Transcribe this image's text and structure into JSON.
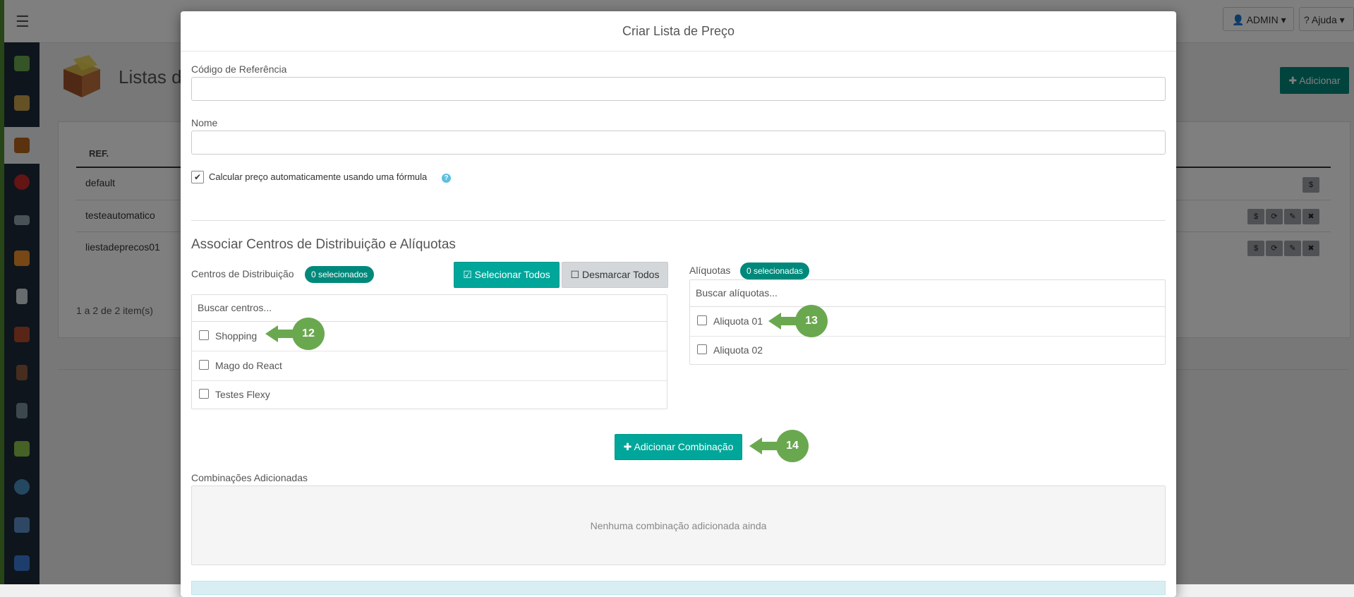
{
  "app": {
    "admin_label": "ADMIN",
    "help_label": "Ajuda",
    "page_title": "Listas de",
    "add_button": "Adicionar",
    "table_header_ref": "REF.",
    "rows": [
      "default",
      "testeautomatico",
      "liestadeprecos01"
    ],
    "count_text": "1 a 2 de 2 item(s)",
    "action_icons": {
      "price": "$",
      "sync": "⟳",
      "edit": "✎",
      "delete": "✖"
    }
  },
  "modal": {
    "title": "Criar Lista de Preço",
    "ref_code_label": "Código de Referência",
    "name_label": "Nome",
    "auto_price_label": "Calcular preço automaticamente usando uma fórmula",
    "auto_price_checked": true,
    "section_title": "Associar Centros de Distribuição e Alíquotas",
    "centers": {
      "label": "Centros de Distribuição",
      "badge": "0 selecionados",
      "select_all": "Selecionar Todos",
      "deselect_all": "Desmarcar Todos",
      "search_placeholder": "Buscar centros...",
      "items": [
        "Shopping",
        "Mago do React",
        "Testes Flexy"
      ]
    },
    "rates": {
      "label": "Alíquotas",
      "badge": "0 selecionadas",
      "search_placeholder": "Buscar alíquotas...",
      "items": [
        "Aliquota 01",
        "Aliquota 02"
      ]
    },
    "add_combination": "Adicionar Combinação",
    "combinations_label": "Combinações Adicionadas",
    "combinations_empty": "Nenhuma combinação adicionada ainda"
  },
  "callouts": [
    "12",
    "13",
    "14"
  ],
  "colors": {
    "teal": "#00a69a",
    "callout_green": "#6aa84f",
    "sidebar_dark": "#1d2b3a"
  }
}
